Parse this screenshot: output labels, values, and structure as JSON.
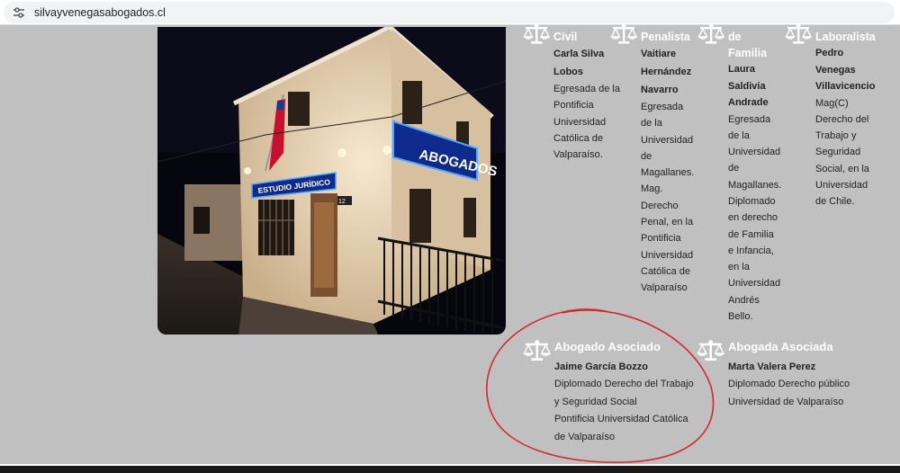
{
  "browser": {
    "url": "silvayvenegasabogados.cl"
  },
  "photo": {
    "sign_abogados": "ABOGADOS",
    "sign_estudio": "ESTUDIO JURÍDICO",
    "house_number": "12"
  },
  "lawyers": [
    {
      "area": "Civil",
      "name": "Carla Silva Lobos",
      "description": "Egresada de la Pontificia Universidad Católica de Valparaíso."
    },
    {
      "area": "Penalista",
      "name": "Vaitiare Hernández Navarro",
      "description": "Egresada de la Universidad de Magallanes. Mag. Derecho Penal, en la Pontificia Universidad Católica de Valparaíso"
    },
    {
      "area": "de Familia",
      "name": "Laura Saldivia Andrade",
      "description": "Egresada de la Universidad de Magallanes. Diplomado en derecho de Familia e Infancia, en la Universidad Andrés Bello."
    },
    {
      "area": "Laboralista",
      "name": "Pedro Venegas Villavicencio",
      "description": "Mag(C) Derecho del Trabajo y Seguridad Social, en la Universidad de Chile."
    }
  ],
  "associates": [
    {
      "title": "Abogado Asociado",
      "name": "Jaime García Bozzo",
      "lines": [
        "Diplomado Derecho del Trabajo",
        "y Seguridad Social",
        "Pontificia Universidad Católica",
        "de Valparaíso"
      ]
    },
    {
      "title": "Abogada Asociada",
      "name": "Marta Valera Perez",
      "lines": [
        "Diplomado Derecho público",
        "Universidad de Valparaíso"
      ]
    }
  ],
  "colors": {
    "background": "#c0c0c0",
    "annotation": "#d62828",
    "heading": "#ffffff",
    "body_text": "#222222"
  }
}
